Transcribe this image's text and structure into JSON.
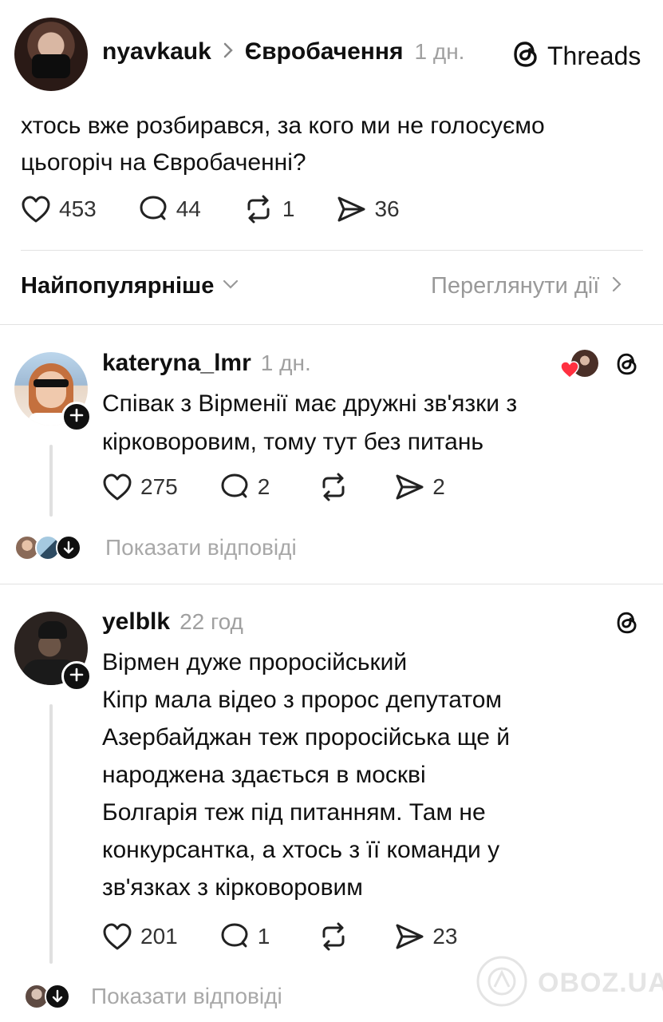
{
  "post": {
    "username": "nyavkauk",
    "community": "Євробачення",
    "time": "1 дн.",
    "brand": "Threads",
    "text_line1": "хтось вже розбирався, за кого ми не голосуємо",
    "text_line2": "цьогоріч на Євробаченні?",
    "likes": "453",
    "comments": "44",
    "reposts": "1",
    "shares": "36"
  },
  "sort": {
    "label": "Найпопулярніше",
    "activity_link": "Переглянути дії"
  },
  "replies": [
    {
      "username": "kateryna_lmr",
      "time": "1 дн.",
      "text_lines": [
        "Співак з Вірменії  має дружні зв'язки з",
        "кірковоровим, тому тут без питань"
      ],
      "likes": "275",
      "comments": "2",
      "shares": "2",
      "show_replies": "Показати відповіді"
    },
    {
      "username": "yelblk",
      "time": "22 год",
      "text_lines": [
        "Вірмен дуже проросійський",
        "Кіпр мала відео з пророс депутатом",
        "Азербайджан теж проросійська ще й",
        "народжена здається в москві",
        "Болгарія теж під питанням. Там не",
        "конкурсантка, а хтось з її команди у",
        "зв'язках з кірковоровим"
      ],
      "likes": "201",
      "comments": "1",
      "shares": "23",
      "show_replies": "Показати відповіді"
    }
  ],
  "watermark": "OBOZ.UA",
  "colors": {
    "heart_red": "#ff3040",
    "text": "#101010",
    "muted": "#999999"
  }
}
